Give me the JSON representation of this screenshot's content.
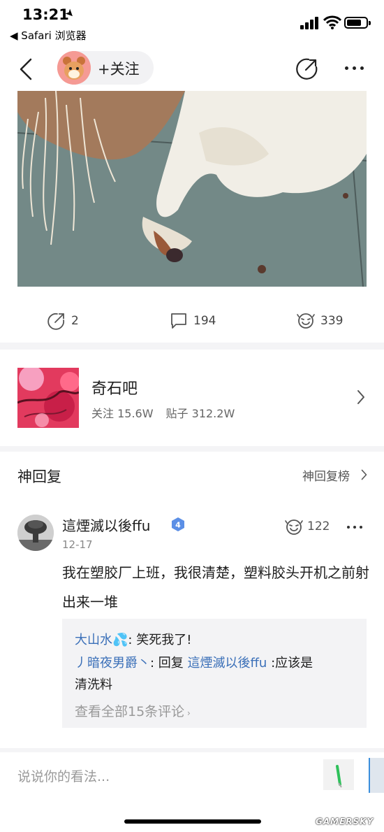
{
  "status_bar": {
    "time": "13:21",
    "back_app": "◀ Safari 浏览器"
  },
  "nav": {
    "follow_label": "+关注"
  },
  "post": {
    "actions": {
      "share_count": "2",
      "comment_count": "194",
      "like_count": "339"
    }
  },
  "forum": {
    "name": "奇石吧",
    "followers_label": "关注 15.6W",
    "posts_label": "贴子 312.2W"
  },
  "replies": {
    "title": "神回复",
    "rank_link": "神回复榜",
    "comment": {
      "author": "這煙滅以後ffu",
      "level": "4",
      "date": "12-17",
      "like_count": "122",
      "text": "我在塑胶厂上班，我很清楚，塑料胶头开机之前射出来一堆",
      "sub_replies": [
        {
          "author": "大山水",
          "author_emoji": "💦",
          "sep": ": ",
          "text": "笑死我了!"
        },
        {
          "author": "丿暗夜男爵丶",
          "sep": ": ",
          "reply_word": "回复 ",
          "reply_to": "這煙滅以後ffu",
          "text_line1": " :应该是",
          "text_line2": "清洗料"
        }
      ],
      "view_all": "查看全部15条评论"
    }
  },
  "input_bar": {
    "placeholder": "说说你的看法..."
  },
  "watermark": "GAMERSKY"
}
